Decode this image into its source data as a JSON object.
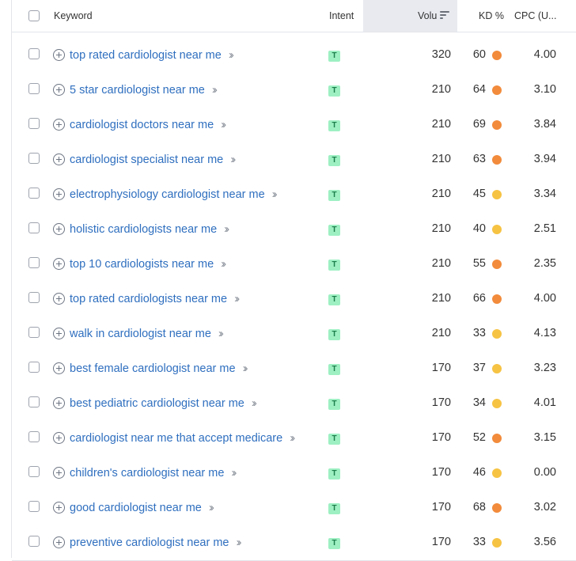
{
  "header": {
    "keyword_label": "Keyword",
    "intent_label": "Intent",
    "volume_label": "Volu",
    "kd_label": "KD %",
    "cpc_label": "CPC (U..."
  },
  "colors": {
    "orange": "#f28b3b",
    "yellow": "#f6c343",
    "link": "#2f6fbf",
    "intent_bg": "#9ef0c3"
  },
  "rows": [
    {
      "keyword": "top rated cardiologist near me",
      "intent": "T",
      "volume": "320",
      "kd": "60",
      "kd_level": "orange",
      "cpc": "4.00"
    },
    {
      "keyword": "5 star cardiologist near me",
      "intent": "T",
      "volume": "210",
      "kd": "64",
      "kd_level": "orange",
      "cpc": "3.10"
    },
    {
      "keyword": "cardiologist doctors near me",
      "intent": "T",
      "volume": "210",
      "kd": "69",
      "kd_level": "orange",
      "cpc": "3.84"
    },
    {
      "keyword": "cardiologist specialist near me",
      "intent": "T",
      "volume": "210",
      "kd": "63",
      "kd_level": "orange",
      "cpc": "3.94"
    },
    {
      "keyword": "electrophysiology cardiologist near me",
      "intent": "T",
      "volume": "210",
      "kd": "45",
      "kd_level": "yellow",
      "cpc": "3.34"
    },
    {
      "keyword": "holistic cardiologists near me",
      "intent": "T",
      "volume": "210",
      "kd": "40",
      "kd_level": "yellow",
      "cpc": "2.51"
    },
    {
      "keyword": "top 10 cardiologists near me",
      "intent": "T",
      "volume": "210",
      "kd": "55",
      "kd_level": "orange",
      "cpc": "2.35"
    },
    {
      "keyword": "top rated cardiologists near me",
      "intent": "T",
      "volume": "210",
      "kd": "66",
      "kd_level": "orange",
      "cpc": "4.00"
    },
    {
      "keyword": "walk in cardiologist near me",
      "intent": "T",
      "volume": "210",
      "kd": "33",
      "kd_level": "yellow",
      "cpc": "4.13"
    },
    {
      "keyword": "best female cardiologist near me",
      "intent": "T",
      "volume": "170",
      "kd": "37",
      "kd_level": "yellow",
      "cpc": "3.23"
    },
    {
      "keyword": "best pediatric cardiologist near me",
      "intent": "T",
      "volume": "170",
      "kd": "34",
      "kd_level": "yellow",
      "cpc": "4.01"
    },
    {
      "keyword": "cardiologist near me that accept medicare",
      "intent": "T",
      "volume": "170",
      "kd": "52",
      "kd_level": "orange",
      "cpc": "3.15"
    },
    {
      "keyword": "children's cardiologist near me",
      "intent": "T",
      "volume": "170",
      "kd": "46",
      "kd_level": "yellow",
      "cpc": "0.00"
    },
    {
      "keyword": "good cardiologist near me",
      "intent": "T",
      "volume": "170",
      "kd": "68",
      "kd_level": "orange",
      "cpc": "3.02"
    },
    {
      "keyword": "preventive cardiologist near me",
      "intent": "T",
      "volume": "170",
      "kd": "33",
      "kd_level": "yellow",
      "cpc": "3.56"
    }
  ]
}
